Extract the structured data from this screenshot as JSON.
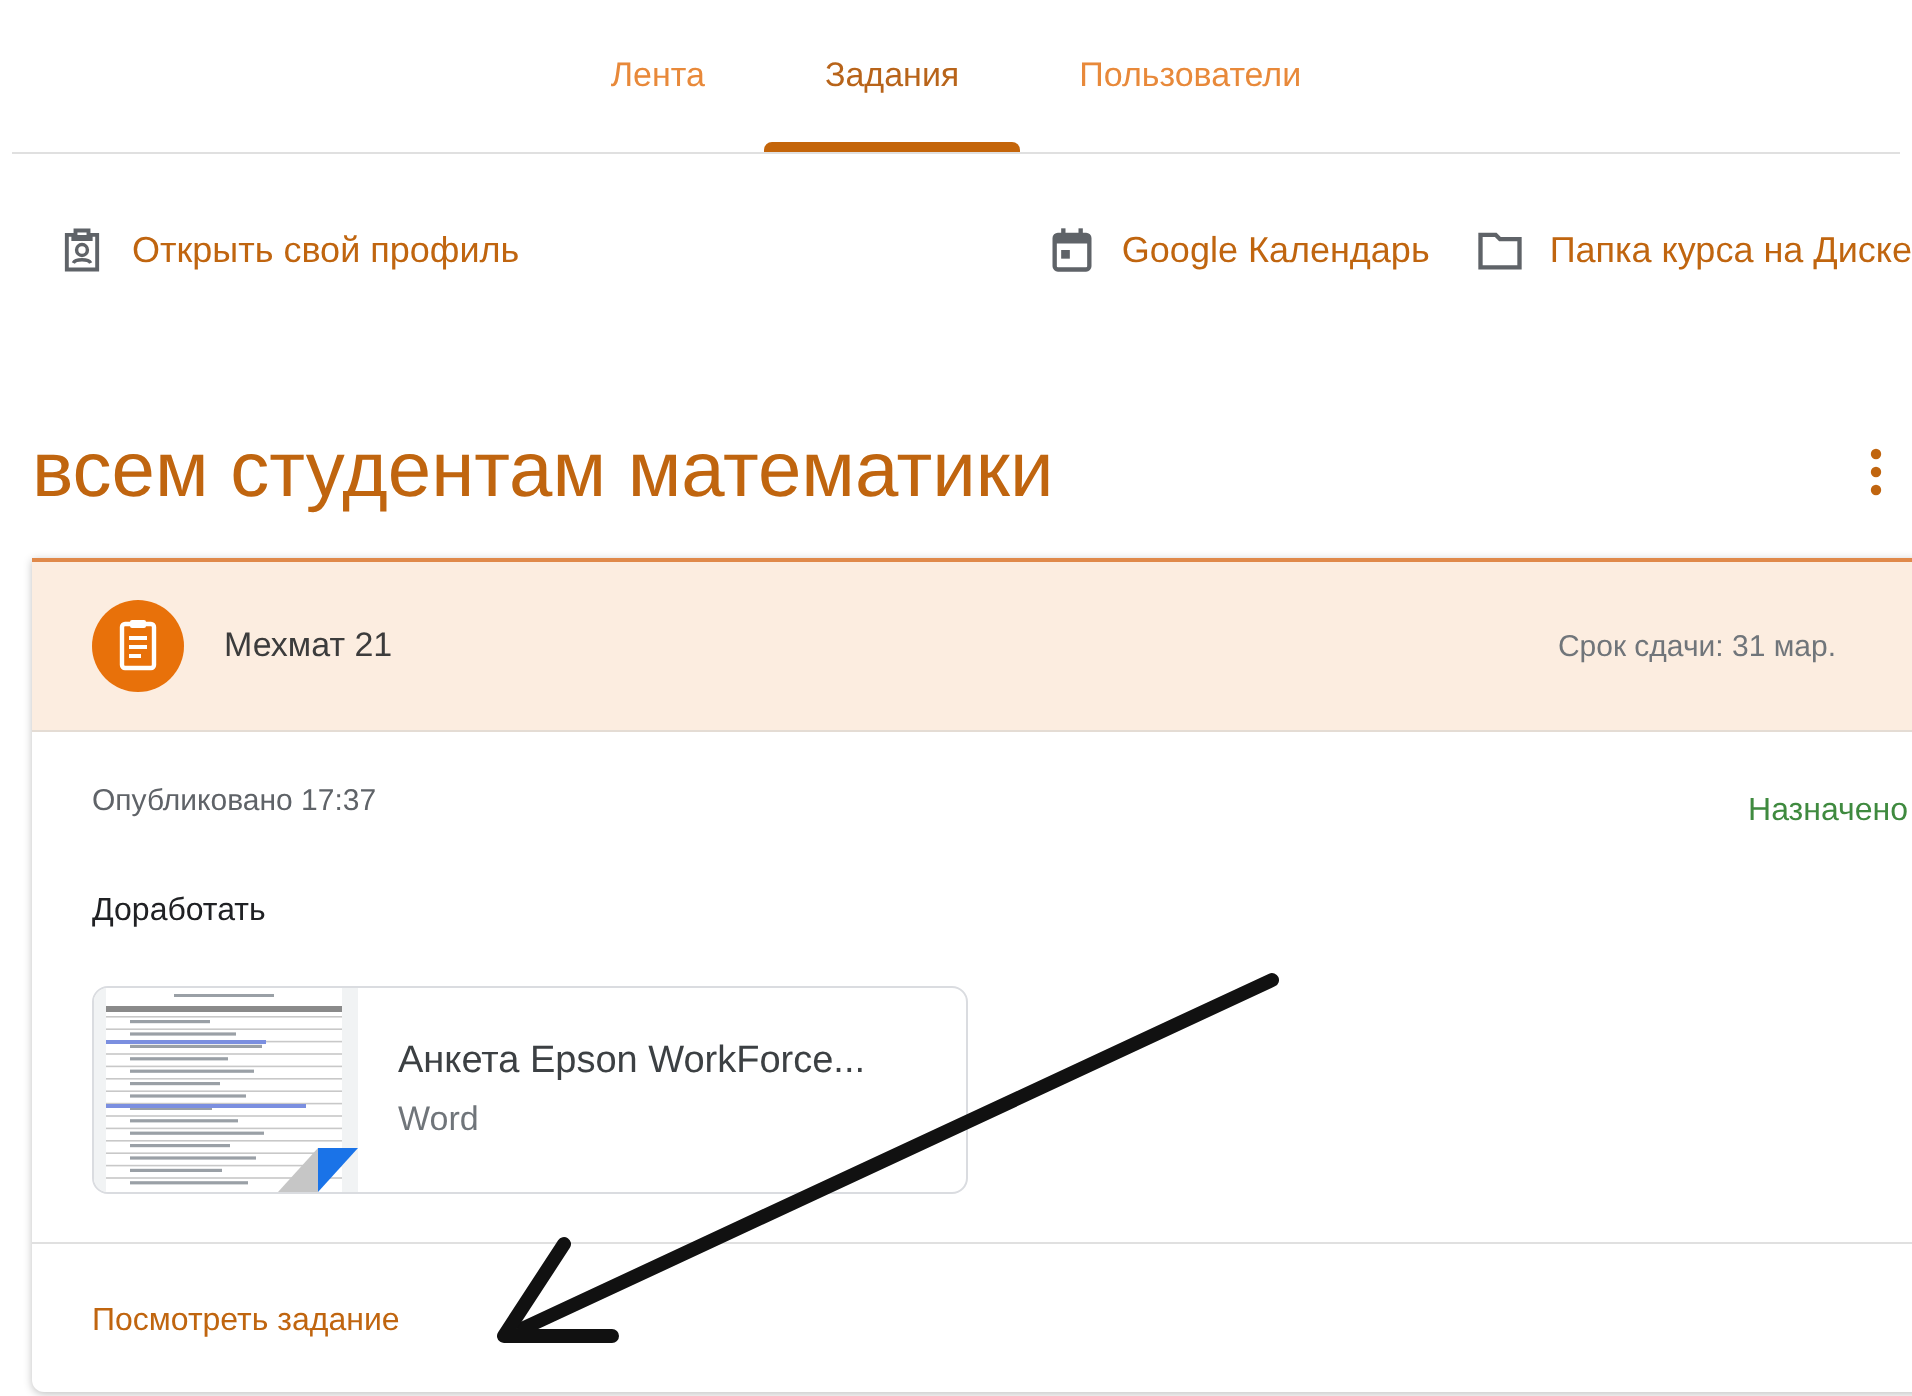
{
  "tabs": [
    {
      "label": "Лента",
      "selected": false
    },
    {
      "label": "Задания",
      "selected": true
    },
    {
      "label": "Пользователи",
      "selected": false
    }
  ],
  "links": [
    {
      "kind": "profile",
      "label": "Открыть свой профиль"
    },
    {
      "kind": "calendar",
      "label": "Google Календарь"
    },
    {
      "kind": "folder",
      "label": "Папка курса на Диске"
    }
  ],
  "topic": {
    "title": "всем студентам математики"
  },
  "assignment": {
    "class_name": "Мехмат 21",
    "due": "Срок сдачи: 31 мар.",
    "published": "Опубликовано 17:37",
    "status": "Назначено",
    "description": "Доработать",
    "attachment": {
      "title": "Анкета Epson WorkForce...",
      "type": "Word"
    },
    "view_link": "Посмотреть задание"
  }
}
